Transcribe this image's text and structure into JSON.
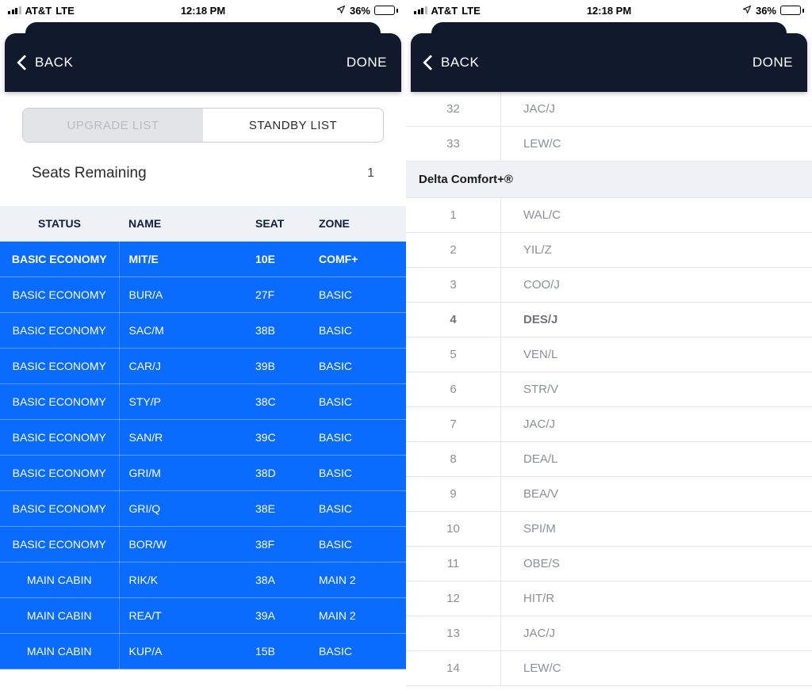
{
  "statusbar": {
    "carrier": "AT&T",
    "network": "LTE",
    "time": "12:18 PM",
    "battery_pct": "36%"
  },
  "nav": {
    "back": "BACK",
    "done": "DONE"
  },
  "segmented": {
    "upgrade": "UPGRADE LIST",
    "standby": "STANDBY LIST"
  },
  "seats": {
    "label": "Seats Remaining",
    "count": "1"
  },
  "table": {
    "headers": {
      "status": "STATUS",
      "name": "NAME",
      "seat": "SEAT",
      "zone": "ZONE"
    },
    "rows": [
      {
        "status": "BASIC ECONOMY",
        "name": "MIT/E",
        "seat": "10E",
        "zone": "COMF+",
        "hl": true
      },
      {
        "status": "BASIC ECONOMY",
        "name": "BUR/A",
        "seat": "27F",
        "zone": "BASIC"
      },
      {
        "status": "BASIC ECONOMY",
        "name": "SAC/M",
        "seat": "38B",
        "zone": "BASIC"
      },
      {
        "status": "BASIC ECONOMY",
        "name": "CAR/J",
        "seat": "39B",
        "zone": "BASIC"
      },
      {
        "status": "BASIC ECONOMY",
        "name": "STY/P",
        "seat": "38C",
        "zone": "BASIC"
      },
      {
        "status": "BASIC ECONOMY",
        "name": "SAN/R",
        "seat": "39C",
        "zone": "BASIC"
      },
      {
        "status": "BASIC ECONOMY",
        "name": "GRI/M",
        "seat": "38D",
        "zone": "BASIC"
      },
      {
        "status": "BASIC ECONOMY",
        "name": "GRI/Q",
        "seat": "38E",
        "zone": "BASIC"
      },
      {
        "status": "BASIC ECONOMY",
        "name": "BOR/W",
        "seat": "38F",
        "zone": "BASIC"
      },
      {
        "status": "MAIN CABIN",
        "name": "RIK/K",
        "seat": "38A",
        "zone": "MAIN 2"
      },
      {
        "status": "MAIN CABIN",
        "name": "REA/T",
        "seat": "39A",
        "zone": "MAIN 2"
      },
      {
        "status": "MAIN CABIN",
        "name": "KUP/A",
        "seat": "15B",
        "zone": "BASIC"
      }
    ]
  },
  "right": {
    "pre_rows": [
      {
        "num": "32",
        "name": "JAC/J"
      },
      {
        "num": "33",
        "name": "LEW/C"
      }
    ],
    "section_title": "Delta Comfort+®",
    "rows": [
      {
        "num": "1",
        "name": "WAL/C"
      },
      {
        "num": "2",
        "name": "YIL/Z"
      },
      {
        "num": "3",
        "name": "COO/J"
      },
      {
        "num": "4",
        "name": "DES/J",
        "bold": true
      },
      {
        "num": "5",
        "name": "VEN/L"
      },
      {
        "num": "6",
        "name": "STR/V"
      },
      {
        "num": "7",
        "name": "JAC/J"
      },
      {
        "num": "8",
        "name": "DEA/L"
      },
      {
        "num": "9",
        "name": "BEA/V"
      },
      {
        "num": "10",
        "name": "SPI/M"
      },
      {
        "num": "11",
        "name": "OBE/S"
      },
      {
        "num": "12",
        "name": "HIT/R"
      },
      {
        "num": "13",
        "name": "JAC/J"
      },
      {
        "num": "14",
        "name": "LEW/C"
      }
    ]
  }
}
